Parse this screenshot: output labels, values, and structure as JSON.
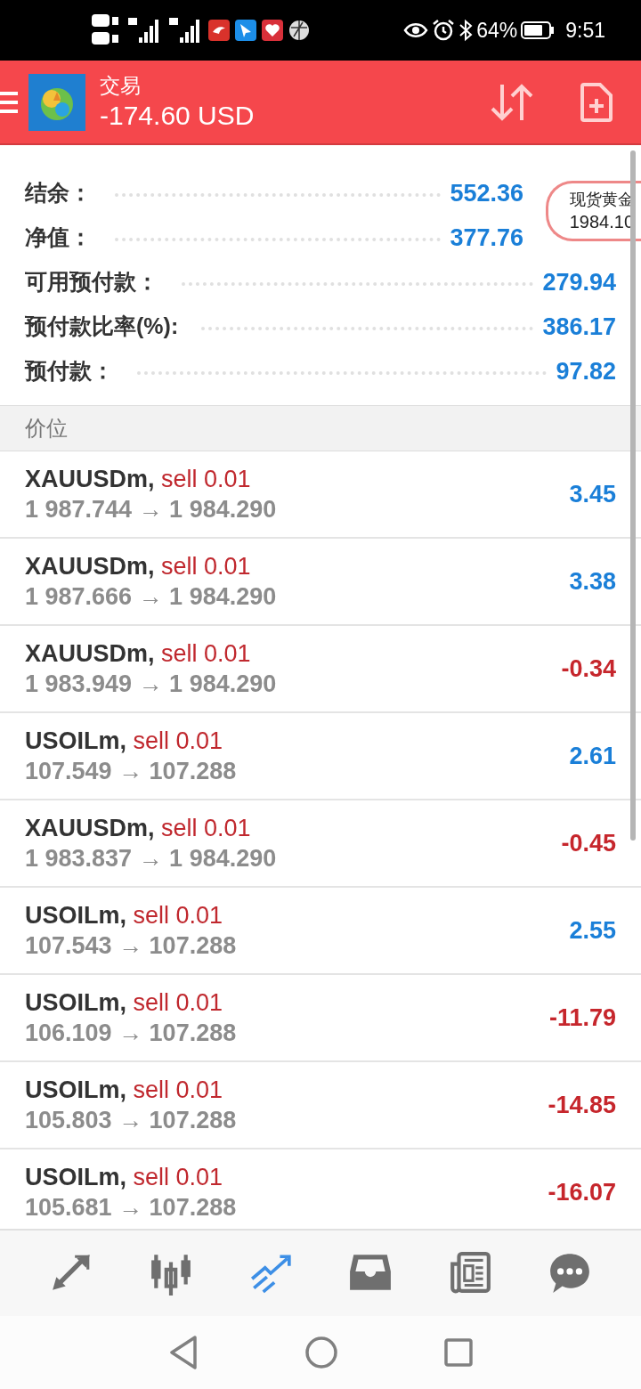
{
  "status_bar": {
    "battery": "64%",
    "time": "9:51"
  },
  "header": {
    "title": "交易",
    "profit": "-174.60 USD"
  },
  "summary": [
    {
      "label": "结余：",
      "value": "552.36"
    },
    {
      "label": "净值：",
      "value": "377.76"
    },
    {
      "label": "可用预付款：",
      "value": "279.94"
    },
    {
      "label": "预付款比率(%):",
      "value": "386.17"
    },
    {
      "label": "预付款：",
      "value": "97.82"
    }
  ],
  "floating_widget": {
    "name": "现货黄金",
    "price": "1984.10"
  },
  "section_title": "价位",
  "positions": [
    {
      "symbol": "XAUUSDm,",
      "side": "sell 0.01",
      "prices": "1 987.744 → 1 984.290",
      "profit": "3.45",
      "color": "#1a7fd8"
    },
    {
      "symbol": "XAUUSDm,",
      "side": "sell 0.01",
      "prices": "1 987.666 → 1 984.290",
      "profit": "3.38",
      "color": "#1a7fd8"
    },
    {
      "symbol": "XAUUSDm,",
      "side": "sell 0.01",
      "prices": "1 983.949 → 1 984.290",
      "profit": "-0.34",
      "color": "#c6262c"
    },
    {
      "symbol": "USOILm,",
      "side": "sell 0.01",
      "prices": "107.549 → 107.288",
      "profit": "2.61",
      "color": "#1a7fd8"
    },
    {
      "symbol": "XAUUSDm,",
      "side": "sell 0.01",
      "prices": "1 983.837 → 1 984.290",
      "profit": "-0.45",
      "color": "#c6262c"
    },
    {
      "symbol": "USOILm,",
      "side": "sell 0.01",
      "prices": "107.543 → 107.288",
      "profit": "2.55",
      "color": "#1a7fd8"
    },
    {
      "symbol": "USOILm,",
      "side": "sell 0.01",
      "prices": "106.109 → 107.288",
      "profit": "-11.79",
      "color": "#c6262c"
    },
    {
      "symbol": "USOILm,",
      "side": "sell 0.01",
      "prices": "105.803 → 107.288",
      "profit": "-14.85",
      "color": "#c6262c"
    },
    {
      "symbol": "USOILm,",
      "side": "sell 0.01",
      "prices": "105.681 → 107.288",
      "profit": "-16.07",
      "color": "#c6262c"
    }
  ],
  "nav": [
    {
      "kind": "quotes",
      "selected": false
    },
    {
      "kind": "chart",
      "selected": false
    },
    {
      "kind": "trade",
      "selected": true
    },
    {
      "kind": "history",
      "selected": false
    },
    {
      "kind": "news",
      "selected": false
    },
    {
      "kind": "chat",
      "selected": false
    }
  ]
}
